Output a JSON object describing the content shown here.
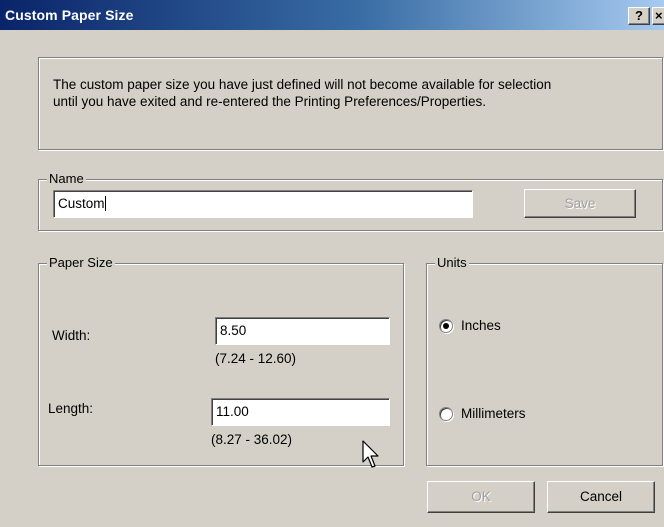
{
  "window": {
    "title": "Custom Paper Size",
    "help_label": "?",
    "close_label": "×"
  },
  "info": {
    "line1": "The custom paper size you have just defined will not become available for selection",
    "line2": "until you have exited and re-entered the Printing Preferences/Properties."
  },
  "name_group": {
    "legend": "Name",
    "value": "Custom",
    "save_label": "Save",
    "save_enabled": false
  },
  "paper_size": {
    "legend": "Paper Size",
    "width": {
      "label": "Width:",
      "value": "8.50",
      "range": "(7.24 - 12.60)"
    },
    "length": {
      "label": "Length:",
      "value": "11.00",
      "range": "(8.27 - 36.02)"
    }
  },
  "units": {
    "legend": "Units",
    "options": [
      {
        "label": "Inches",
        "selected": true
      },
      {
        "label": "Millimeters",
        "selected": false
      }
    ]
  },
  "footer": {
    "ok_label": "OK",
    "ok_enabled": false,
    "cancel_label": "Cancel"
  },
  "colors": {
    "dialog_face": "#d4d0c8",
    "title_gradient_start": "#0a246a",
    "title_gradient_end": "#a6caf0"
  },
  "icons": [
    "help-icon",
    "close-icon",
    "radio-selected-icon",
    "radio-unselected-icon",
    "mouse-pointer-icon"
  ]
}
